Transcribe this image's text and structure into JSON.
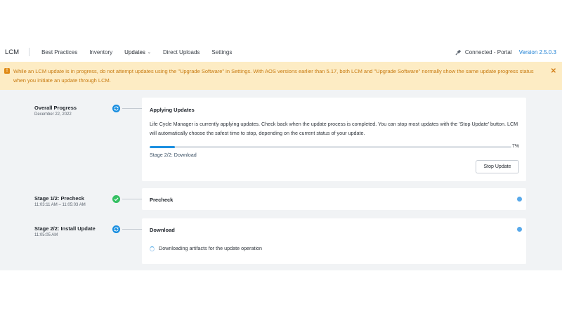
{
  "nav": {
    "brand": "LCM",
    "items": [
      {
        "label": "Best Practices"
      },
      {
        "label": "Inventory"
      },
      {
        "label": "Updates",
        "caret": "⌄"
      },
      {
        "label": "Direct Uploads"
      },
      {
        "label": "Settings"
      }
    ],
    "connection": "Connected - Portal",
    "version": "Version 2.5.0.3",
    "connection_icon": "plug-icon"
  },
  "alert": {
    "icon": "warning-icon",
    "icon_glyph": "!",
    "text": "While an LCM update is in progress, do not attempt updates using the \"Upgrade Software\" in Settings. With AOS versions earlier than 5.17, both LCM and \"Upgrade Software\" normally show the same update progress status when you initiate an update through LCM.",
    "close_glyph": "✕"
  },
  "progress": {
    "overall_label": "Overall Progress",
    "overall_date": "December 22, 2022",
    "card_title": "Applying Updates",
    "description": "Life Cycle Manager is currently applying updates. Check back when the update process is completed. You can stop most updates with the 'Stop Update' button. LCM will automatically choose the safest time to stop, depending on the current status of your update.",
    "percent": 7,
    "percent_label": "7%",
    "stage_text": "Stage 2/2: Download",
    "stop_button": "Stop Update"
  },
  "stages": [
    {
      "label": "Stage 1/2: Precheck",
      "time": "11:03:11 AM – 11:05:03 AM",
      "card_title": "Precheck",
      "status": "complete"
    },
    {
      "label": "Stage 2/2: Install Update",
      "time": "11:05:05 AM",
      "card_title": "Download",
      "status": "in-progress",
      "detail": "Downloading artifacts for the update operation"
    }
  ],
  "colors": {
    "accent": "#1b8fe0",
    "success": "#35c063",
    "alert_bg": "#fdecc4",
    "alert_text": "#c77a10",
    "link": "#1b7fd4"
  }
}
